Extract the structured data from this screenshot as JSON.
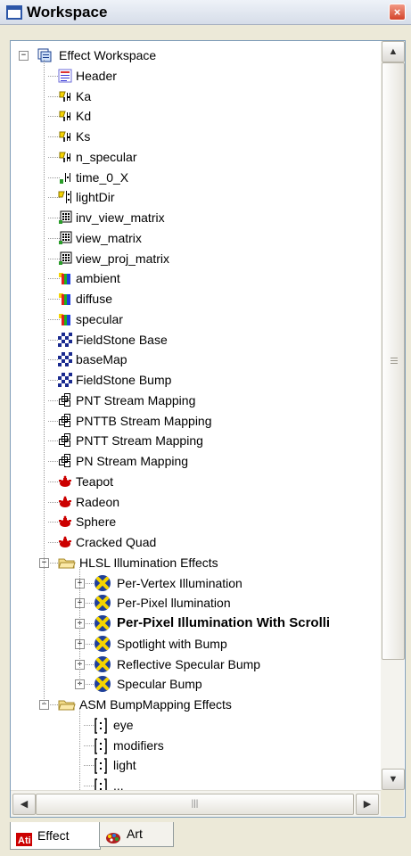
{
  "window": {
    "title": "Workspace",
    "close_label": "×"
  },
  "tree": {
    "items": [
      {
        "label": "Effect Workspace",
        "depth": 0,
        "expander": "−",
        "icon": "workspace-icon"
      },
      {
        "label": "Header",
        "depth": 1,
        "icon": "header-icon"
      },
      {
        "label": "Ka",
        "depth": 1,
        "icon": "scalar-param-icon"
      },
      {
        "label": "Kd",
        "depth": 1,
        "icon": "scalar-param-icon"
      },
      {
        "label": "Ks",
        "depth": 1,
        "icon": "scalar-param-icon"
      },
      {
        "label": "n_specular",
        "depth": 1,
        "icon": "scalar-param-icon"
      },
      {
        "label": "time_0_X",
        "depth": 1,
        "icon": "time-param-icon"
      },
      {
        "label": "lightDir",
        "depth": 1,
        "icon": "vector-param-icon"
      },
      {
        "label": "inv_view_matrix",
        "depth": 1,
        "icon": "matrix-icon"
      },
      {
        "label": "view_matrix",
        "depth": 1,
        "icon": "matrix-icon"
      },
      {
        "label": "view_proj_matrix",
        "depth": 1,
        "icon": "matrix-icon"
      },
      {
        "label": "ambient",
        "depth": 1,
        "icon": "color-icon"
      },
      {
        "label": "diffuse",
        "depth": 1,
        "icon": "color-icon"
      },
      {
        "label": "specular",
        "depth": 1,
        "icon": "color-icon"
      },
      {
        "label": "FieldStone Base",
        "depth": 1,
        "icon": "texture-icon"
      },
      {
        "label": "baseMap",
        "depth": 1,
        "icon": "texture-icon"
      },
      {
        "label": "FieldStone Bump",
        "depth": 1,
        "icon": "texture-icon"
      },
      {
        "label": "PNT Stream Mapping",
        "depth": 1,
        "icon": "stream-mapping-icon"
      },
      {
        "label": "PNTTB Stream Mapping",
        "depth": 1,
        "icon": "stream-mapping-icon"
      },
      {
        "label": "PNTT Stream Mapping",
        "depth": 1,
        "icon": "stream-mapping-icon"
      },
      {
        "label": "PN Stream Mapping",
        "depth": 1,
        "icon": "stream-mapping-icon"
      },
      {
        "label": "Teapot",
        "depth": 1,
        "icon": "model-icon"
      },
      {
        "label": "Radeon",
        "depth": 1,
        "icon": "model-icon"
      },
      {
        "label": "Sphere",
        "depth": 1,
        "icon": "model-icon"
      },
      {
        "label": "Cracked Quad",
        "depth": 1,
        "icon": "model-icon"
      },
      {
        "label": "HLSL Illumination Effects",
        "depth": 1,
        "expander": "−",
        "icon": "folder-icon"
      },
      {
        "label": "Per-Vertex Illumination",
        "depth": 2,
        "expander": "+",
        "icon": "effect-icon"
      },
      {
        "label": "Per-Pixel llumination",
        "depth": 2,
        "expander": "+",
        "icon": "effect-icon"
      },
      {
        "label": "Per-Pixel Illumination With Scrolli",
        "depth": 2,
        "expander": "+",
        "icon": "effect-icon",
        "bold": true
      },
      {
        "label": "Spotlight with Bump",
        "depth": 2,
        "expander": "+",
        "icon": "effect-icon"
      },
      {
        "label": "Reflective Specular Bump",
        "depth": 2,
        "expander": "+",
        "icon": "effect-icon"
      },
      {
        "label": "Specular Bump",
        "depth": 2,
        "expander": "+",
        "icon": "effect-icon"
      },
      {
        "label": "ASM BumpMapping Effects",
        "depth": 1,
        "expander": "−",
        "icon": "folder-icon"
      },
      {
        "label": "eye",
        "depth": 2,
        "icon": "bracket-var-icon"
      },
      {
        "label": "modifiers",
        "depth": 2,
        "icon": "bracket-var-icon"
      },
      {
        "label": "light",
        "depth": 2,
        "icon": "bracket-var-icon"
      },
      {
        "label": "...",
        "depth": 2,
        "icon": "bracket-var-icon"
      }
    ]
  },
  "scrollbars": {
    "up_arrow": "▲",
    "down_arrow": "▼",
    "left_arrow": "◀",
    "right_arrow": "▶",
    "hgrip": "|||"
  },
  "tabs": [
    {
      "label": "Effect",
      "icon": "ati-logo-icon",
      "active": true
    },
    {
      "label": "Art",
      "icon": "art-palette-icon",
      "active": false
    }
  ],
  "colors": {
    "selection": "#316ac5",
    "tree_lines": "#9a9a9a",
    "accent_red": "#cc0000"
  }
}
